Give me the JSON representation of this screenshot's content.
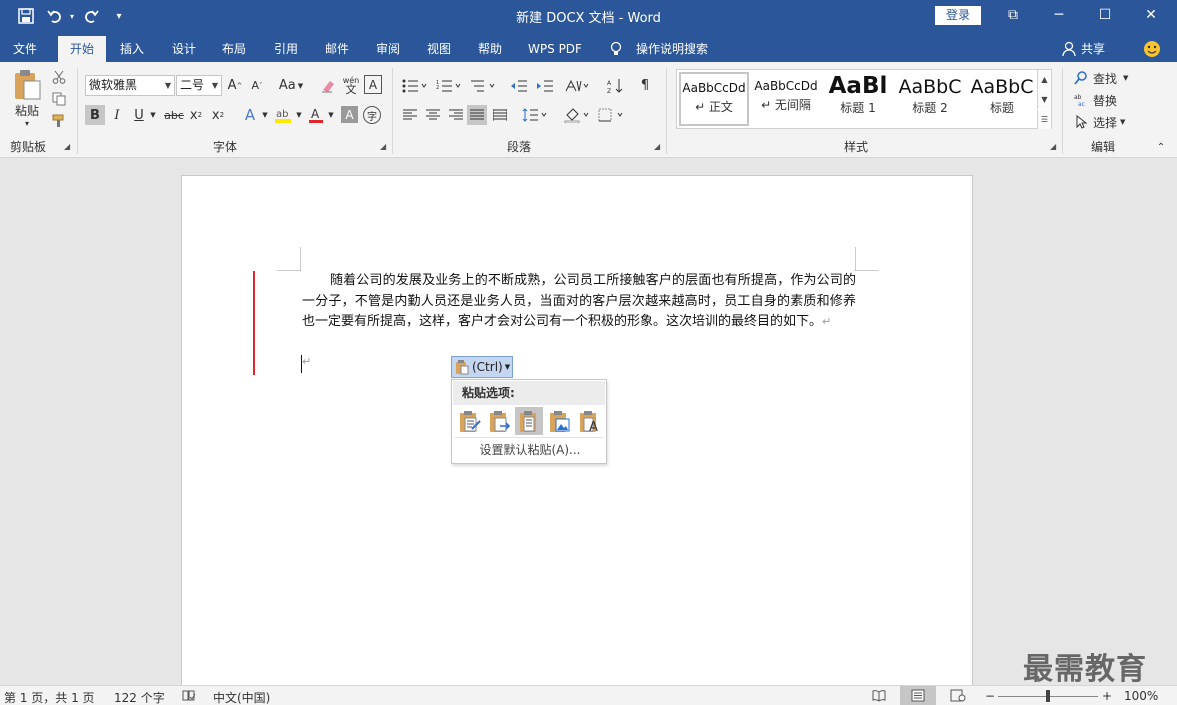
{
  "title_bar": {
    "title": "新建 DOCX 文档  -  Word",
    "login": "登录",
    "minimize": "─",
    "maximize": "☐",
    "close": "✕",
    "ribbon_display": "⧉"
  },
  "quick_access": {
    "save_icon": "save-icon",
    "undo_icon": "undo-icon",
    "redo_icon": "redo-icon",
    "customize_icon": "customize-icon"
  },
  "tabs": [
    {
      "label": "文件"
    },
    {
      "label": "开始"
    },
    {
      "label": "插入"
    },
    {
      "label": "设计"
    },
    {
      "label": "布局"
    },
    {
      "label": "引用"
    },
    {
      "label": "邮件"
    },
    {
      "label": "审阅"
    },
    {
      "label": "视图"
    },
    {
      "label": "帮助"
    },
    {
      "label": "WPS PDF"
    },
    {
      "label": "操作说明搜索"
    }
  ],
  "share": "共享",
  "ribbon": {
    "clipboard": {
      "label": "剪贴板",
      "paste": "粘贴"
    },
    "font": {
      "label": "字体",
      "font_name": "微软雅黑",
      "font_size": "二号",
      "change_case": "Aa",
      "phonetic": "wén"
    },
    "paragraph": {
      "label": "段落"
    },
    "styles": {
      "label": "样式",
      "items": [
        {
          "sample": "AaBbCcDd",
          "name": "↵ 正文"
        },
        {
          "sample": "AaBbCcDd",
          "name": "↵ 无间隔"
        },
        {
          "sample": "AaBl",
          "name": "标题 1"
        },
        {
          "sample": "AaBbC",
          "name": "标题 2"
        },
        {
          "sample": "AaBbC",
          "name": "标题"
        }
      ]
    },
    "editing": {
      "label": "编辑",
      "find": "查找",
      "replace": "替换",
      "select": "选择"
    }
  },
  "document": {
    "paragraph": "随着公司的发展及业务上的不断成熟，公司员工所接触客户的层面也有所提高，作为公司的一分子，不管是内勤人员还是业务人员，当面对的客户层次越来越高时，员工自身的素质和修养也一定要有所提高，这样，客户才会对公司有一个积极的形象。这次培训的最终目的如下。",
    "pilcrow": "↵"
  },
  "paste_options": {
    "button_label": "(Ctrl)",
    "header": "粘贴选项:",
    "default_label": "设置默认粘贴(A)...",
    "icons": [
      "keep-source-formatting-icon",
      "merge-formatting-icon",
      "picture-icon",
      "keep-text-only-icon",
      "text-only-icon"
    ]
  },
  "status_bar": {
    "page": "第 1 页，共 1 页",
    "words": "122 个字",
    "language": "中文(中国)",
    "zoom": "100%",
    "zoom_minus": "−",
    "zoom_plus": "+"
  },
  "watermark": "最需教育",
  "colors": {
    "title_bar": "#2b579a",
    "ribbon": "#f3f3f3",
    "change_bar": "#e0262a",
    "font_color": "#e0262a",
    "highlight": "#ffe800"
  }
}
